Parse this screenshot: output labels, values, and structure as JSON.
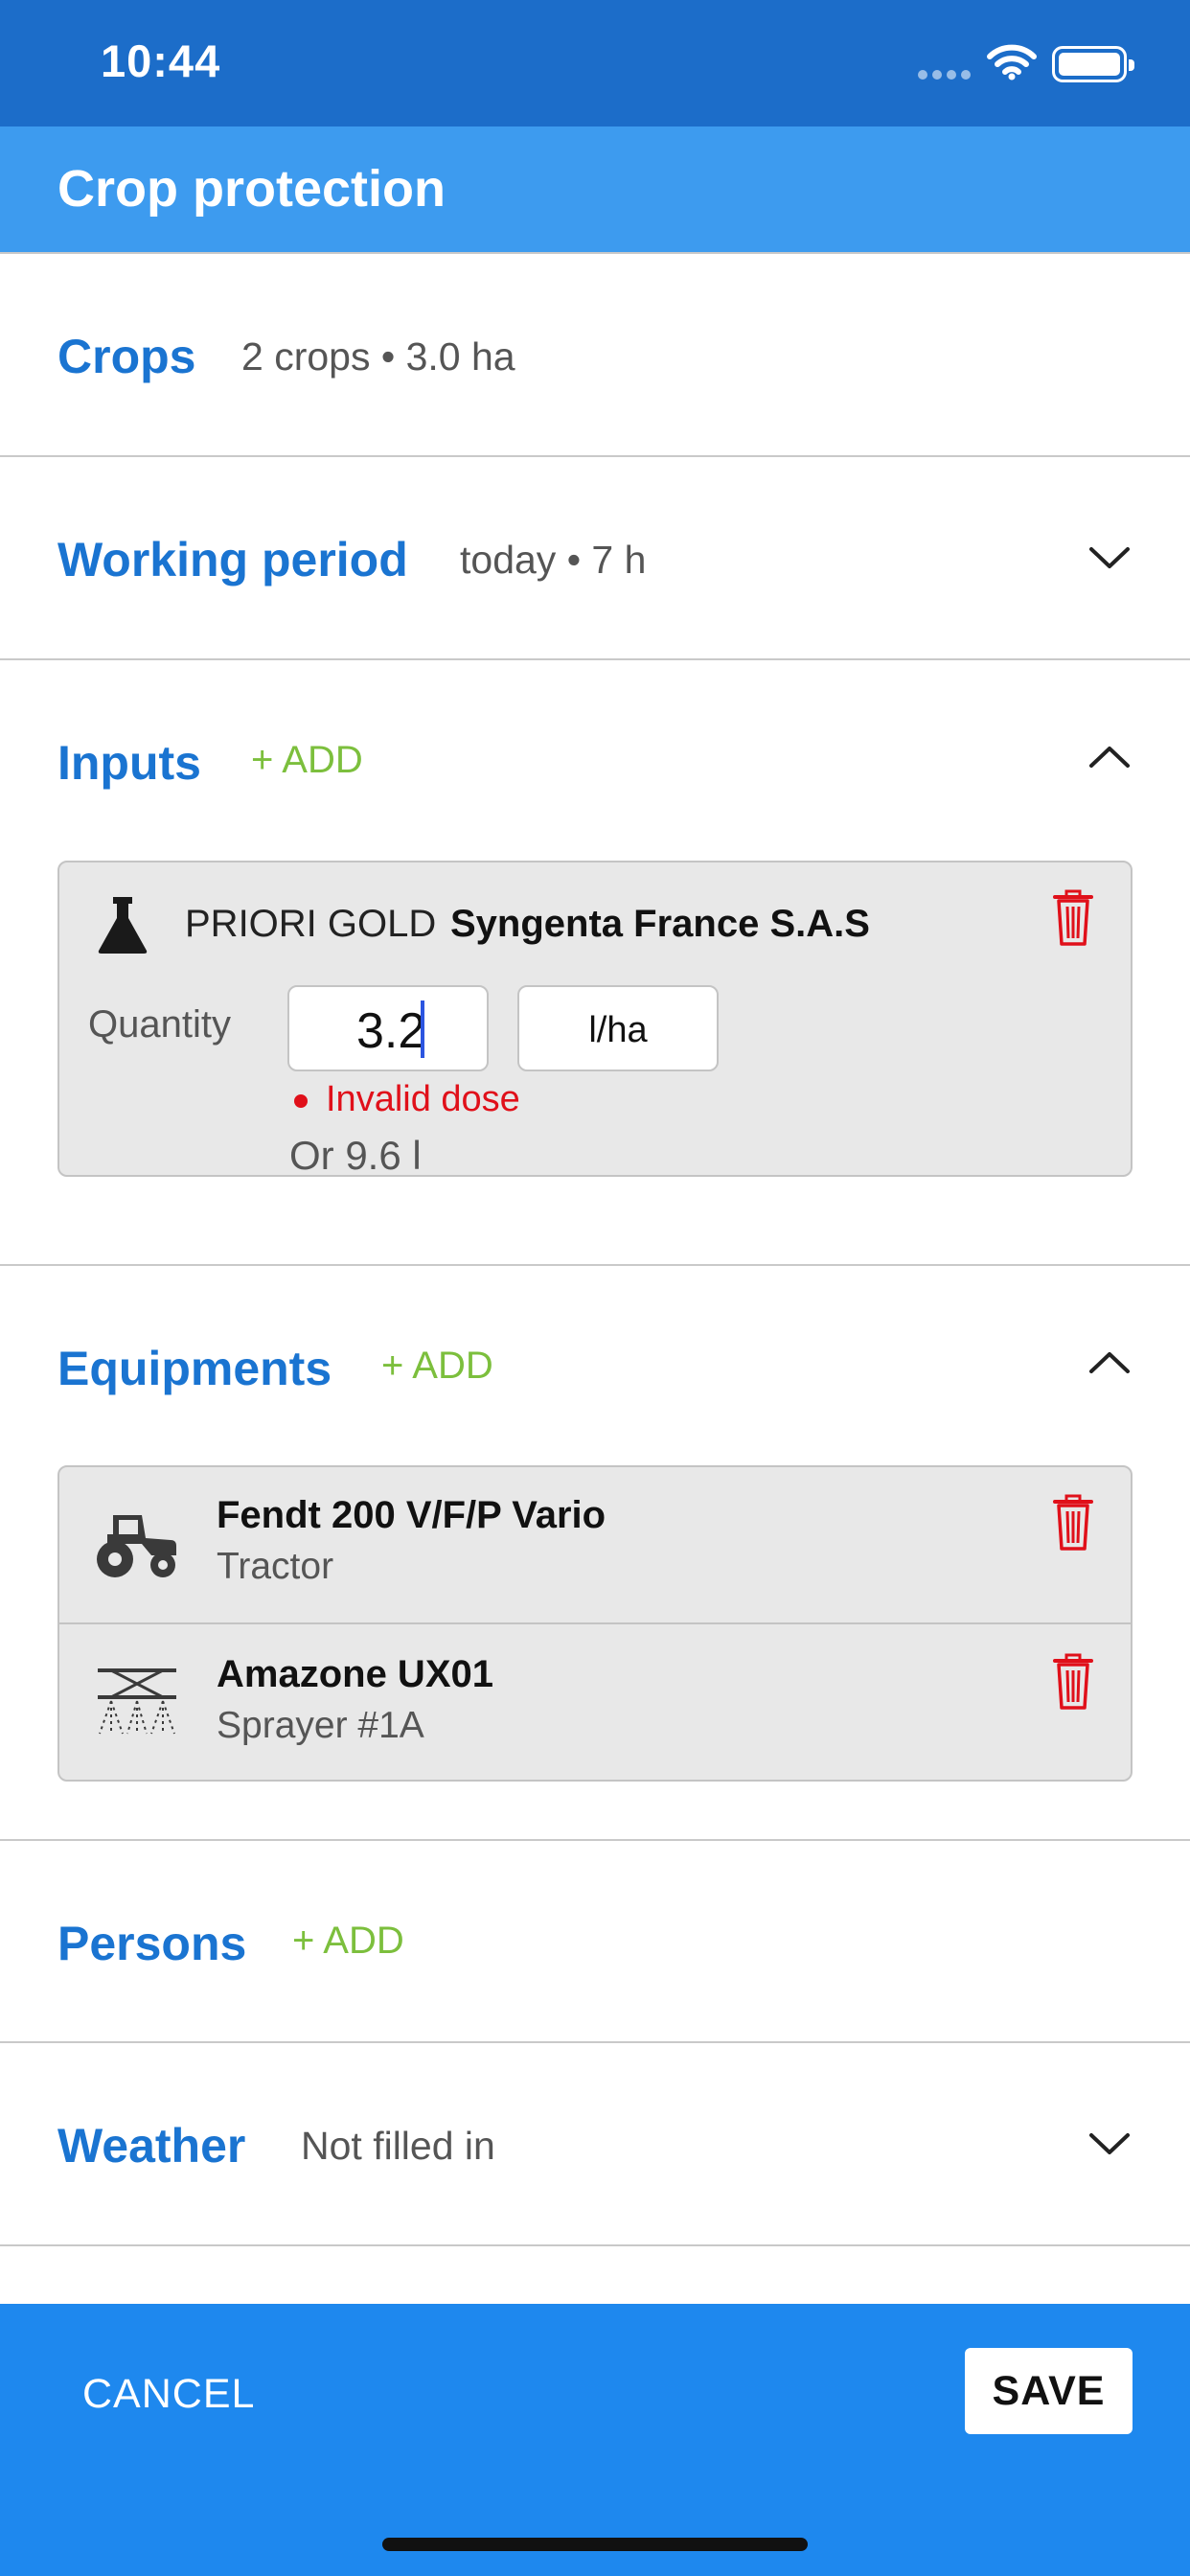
{
  "status_bar": {
    "time": "10:44"
  },
  "app_bar": {
    "title": "Crop protection"
  },
  "crops": {
    "title": "Crops",
    "summary": "2 crops • 3.0 ha"
  },
  "working_period": {
    "title": "Working period",
    "summary": "today • 7 h"
  },
  "inputs": {
    "title": "Inputs",
    "add_label": "+ ADD",
    "items": [
      {
        "product": "PRIORI GOLD",
        "company": "Syngenta France S.A.S",
        "quantity_label": "Quantity",
        "quantity_value": "3.2",
        "unit": "l/ha",
        "error": "Invalid dose",
        "total": "Or 9.6 l"
      }
    ]
  },
  "equipments": {
    "title": "Equipments",
    "add_label": "+ ADD",
    "items": [
      {
        "name": "Fendt 200 V/F/P Vario",
        "type": "Tractor",
        "icon": "tractor-icon"
      },
      {
        "name": "Amazone UX01",
        "type": "Sprayer #1A",
        "icon": "sprayer-icon"
      }
    ]
  },
  "persons": {
    "title": "Persons",
    "add_label": "+ ADD"
  },
  "weather": {
    "title": "Weather",
    "summary": "Not filled in"
  },
  "footer": {
    "cancel_label": "CANCEL",
    "save_label": "SAVE"
  },
  "colors": {
    "status_bar": "#1c6dc9",
    "app_bar": "#3d9bef",
    "section_title": "#1a74d1",
    "add": "#7cbf3d",
    "error": "#e0101a",
    "bottom_bar": "#1e88ee"
  }
}
